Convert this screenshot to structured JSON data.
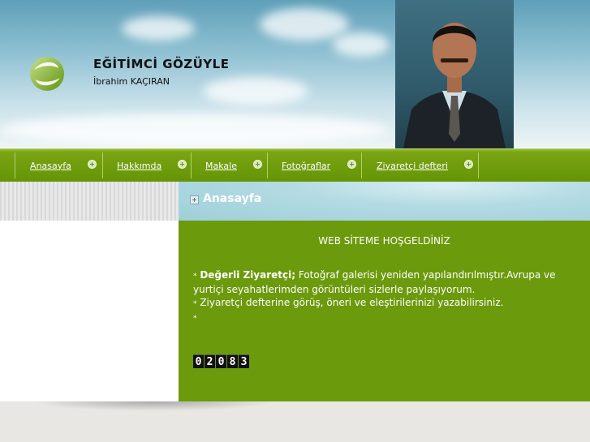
{
  "header": {
    "title": "EĞİTİMCİ GÖZÜYLE",
    "subtitle": "İbrahim KAÇIRAN",
    "logo_icon": "swirl-logo-icon",
    "portrait": "portrait-photo"
  },
  "nav": {
    "items": [
      {
        "label": "Anasayfa"
      },
      {
        "label": "Hakkımda"
      },
      {
        "label": "Makale"
      },
      {
        "label": "Fotoğraflar"
      },
      {
        "label": "Ziyaretçi defteri"
      }
    ],
    "item_icon": "plus-circle-icon"
  },
  "section": {
    "title": "Anasayfa",
    "icon": "plus-square-icon"
  },
  "content": {
    "welcome": "WEB SİTEME HOŞGELDİNİZ",
    "bullet": "*",
    "bold_lead": "Değerli Ziyaretçi;",
    "line1": "Fotoğraf galerisi yeniden yapılandırılmıştır.Avrupa ve yurtiçi seyahatlerimden görüntüleri sizlerle paylaşıyorum.",
    "line2": "Ziyaretçi defterine görüş, öneri ve eleştirilerinizi yazabilirsiniz.",
    "counter": [
      "0",
      "2",
      "0",
      "8",
      "3"
    ]
  },
  "colors": {
    "nav_green": "#649406",
    "content_green": "#6b9a0c",
    "header_blue": "#8ec0d2"
  }
}
